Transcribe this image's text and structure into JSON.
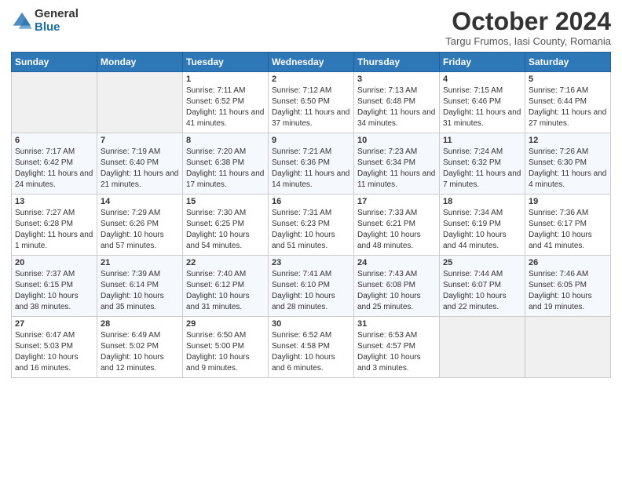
{
  "header": {
    "logo_general": "General",
    "logo_blue": "Blue",
    "month": "October 2024",
    "location": "Targu Frumos, Iasi County, Romania"
  },
  "days_of_week": [
    "Sunday",
    "Monday",
    "Tuesday",
    "Wednesday",
    "Thursday",
    "Friday",
    "Saturday"
  ],
  "weeks": [
    [
      {
        "day": "",
        "sunrise": "",
        "sunset": "",
        "daylight": ""
      },
      {
        "day": "",
        "sunrise": "",
        "sunset": "",
        "daylight": ""
      },
      {
        "day": "1",
        "sunrise": "Sunrise: 7:11 AM",
        "sunset": "Sunset: 6:52 PM",
        "daylight": "Daylight: 11 hours and 41 minutes."
      },
      {
        "day": "2",
        "sunrise": "Sunrise: 7:12 AM",
        "sunset": "Sunset: 6:50 PM",
        "daylight": "Daylight: 11 hours and 37 minutes."
      },
      {
        "day": "3",
        "sunrise": "Sunrise: 7:13 AM",
        "sunset": "Sunset: 6:48 PM",
        "daylight": "Daylight: 11 hours and 34 minutes."
      },
      {
        "day": "4",
        "sunrise": "Sunrise: 7:15 AM",
        "sunset": "Sunset: 6:46 PM",
        "daylight": "Daylight: 11 hours and 31 minutes."
      },
      {
        "day": "5",
        "sunrise": "Sunrise: 7:16 AM",
        "sunset": "Sunset: 6:44 PM",
        "daylight": "Daylight: 11 hours and 27 minutes."
      }
    ],
    [
      {
        "day": "6",
        "sunrise": "Sunrise: 7:17 AM",
        "sunset": "Sunset: 6:42 PM",
        "daylight": "Daylight: 11 hours and 24 minutes."
      },
      {
        "day": "7",
        "sunrise": "Sunrise: 7:19 AM",
        "sunset": "Sunset: 6:40 PM",
        "daylight": "Daylight: 11 hours and 21 minutes."
      },
      {
        "day": "8",
        "sunrise": "Sunrise: 7:20 AM",
        "sunset": "Sunset: 6:38 PM",
        "daylight": "Daylight: 11 hours and 17 minutes."
      },
      {
        "day": "9",
        "sunrise": "Sunrise: 7:21 AM",
        "sunset": "Sunset: 6:36 PM",
        "daylight": "Daylight: 11 hours and 14 minutes."
      },
      {
        "day": "10",
        "sunrise": "Sunrise: 7:23 AM",
        "sunset": "Sunset: 6:34 PM",
        "daylight": "Daylight: 11 hours and 11 minutes."
      },
      {
        "day": "11",
        "sunrise": "Sunrise: 7:24 AM",
        "sunset": "Sunset: 6:32 PM",
        "daylight": "Daylight: 11 hours and 7 minutes."
      },
      {
        "day": "12",
        "sunrise": "Sunrise: 7:26 AM",
        "sunset": "Sunset: 6:30 PM",
        "daylight": "Daylight: 11 hours and 4 minutes."
      }
    ],
    [
      {
        "day": "13",
        "sunrise": "Sunrise: 7:27 AM",
        "sunset": "Sunset: 6:28 PM",
        "daylight": "Daylight: 11 hours and 1 minute."
      },
      {
        "day": "14",
        "sunrise": "Sunrise: 7:29 AM",
        "sunset": "Sunset: 6:26 PM",
        "daylight": "Daylight: 10 hours and 57 minutes."
      },
      {
        "day": "15",
        "sunrise": "Sunrise: 7:30 AM",
        "sunset": "Sunset: 6:25 PM",
        "daylight": "Daylight: 10 hours and 54 minutes."
      },
      {
        "day": "16",
        "sunrise": "Sunrise: 7:31 AM",
        "sunset": "Sunset: 6:23 PM",
        "daylight": "Daylight: 10 hours and 51 minutes."
      },
      {
        "day": "17",
        "sunrise": "Sunrise: 7:33 AM",
        "sunset": "Sunset: 6:21 PM",
        "daylight": "Daylight: 10 hours and 48 minutes."
      },
      {
        "day": "18",
        "sunrise": "Sunrise: 7:34 AM",
        "sunset": "Sunset: 6:19 PM",
        "daylight": "Daylight: 10 hours and 44 minutes."
      },
      {
        "day": "19",
        "sunrise": "Sunrise: 7:36 AM",
        "sunset": "Sunset: 6:17 PM",
        "daylight": "Daylight: 10 hours and 41 minutes."
      }
    ],
    [
      {
        "day": "20",
        "sunrise": "Sunrise: 7:37 AM",
        "sunset": "Sunset: 6:15 PM",
        "daylight": "Daylight: 10 hours and 38 minutes."
      },
      {
        "day": "21",
        "sunrise": "Sunrise: 7:39 AM",
        "sunset": "Sunset: 6:14 PM",
        "daylight": "Daylight: 10 hours and 35 minutes."
      },
      {
        "day": "22",
        "sunrise": "Sunrise: 7:40 AM",
        "sunset": "Sunset: 6:12 PM",
        "daylight": "Daylight: 10 hours and 31 minutes."
      },
      {
        "day": "23",
        "sunrise": "Sunrise: 7:41 AM",
        "sunset": "Sunset: 6:10 PM",
        "daylight": "Daylight: 10 hours and 28 minutes."
      },
      {
        "day": "24",
        "sunrise": "Sunrise: 7:43 AM",
        "sunset": "Sunset: 6:08 PM",
        "daylight": "Daylight: 10 hours and 25 minutes."
      },
      {
        "day": "25",
        "sunrise": "Sunrise: 7:44 AM",
        "sunset": "Sunset: 6:07 PM",
        "daylight": "Daylight: 10 hours and 22 minutes."
      },
      {
        "day": "26",
        "sunrise": "Sunrise: 7:46 AM",
        "sunset": "Sunset: 6:05 PM",
        "daylight": "Daylight: 10 hours and 19 minutes."
      }
    ],
    [
      {
        "day": "27",
        "sunrise": "Sunrise: 6:47 AM",
        "sunset": "Sunset: 5:03 PM",
        "daylight": "Daylight: 10 hours and 16 minutes."
      },
      {
        "day": "28",
        "sunrise": "Sunrise: 6:49 AM",
        "sunset": "Sunset: 5:02 PM",
        "daylight": "Daylight: 10 hours and 12 minutes."
      },
      {
        "day": "29",
        "sunrise": "Sunrise: 6:50 AM",
        "sunset": "Sunset: 5:00 PM",
        "daylight": "Daylight: 10 hours and 9 minutes."
      },
      {
        "day": "30",
        "sunrise": "Sunrise: 6:52 AM",
        "sunset": "Sunset: 4:58 PM",
        "daylight": "Daylight: 10 hours and 6 minutes."
      },
      {
        "day": "31",
        "sunrise": "Sunrise: 6:53 AM",
        "sunset": "Sunset: 4:57 PM",
        "daylight": "Daylight: 10 hours and 3 minutes."
      },
      {
        "day": "",
        "sunrise": "",
        "sunset": "",
        "daylight": ""
      },
      {
        "day": "",
        "sunrise": "",
        "sunset": "",
        "daylight": ""
      }
    ]
  ]
}
